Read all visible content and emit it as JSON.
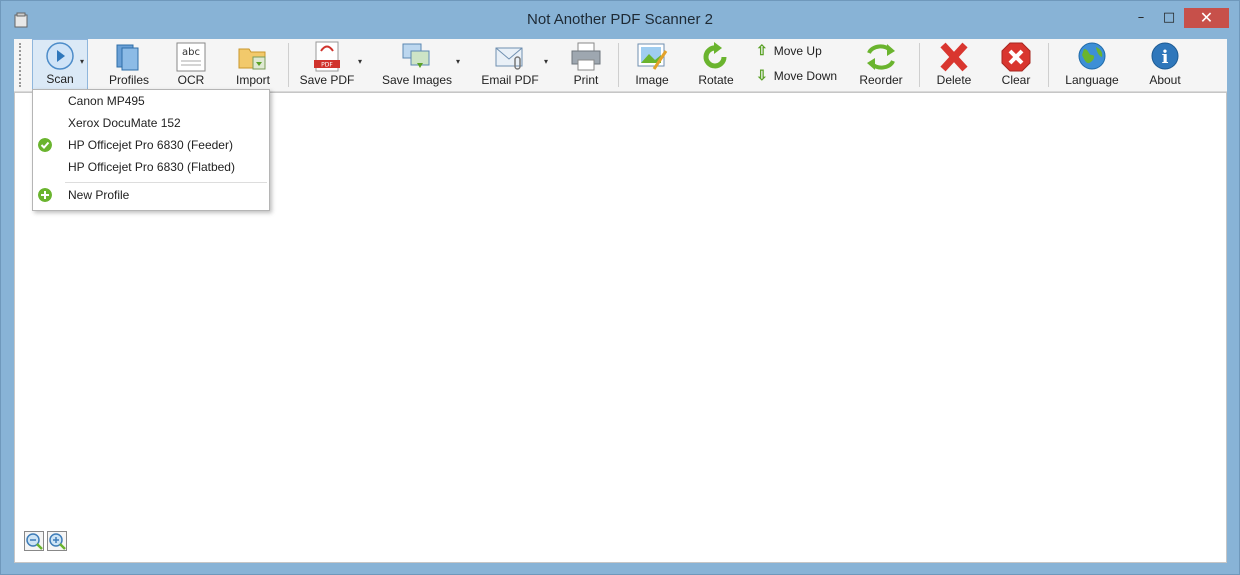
{
  "window": {
    "title": "Not Another PDF Scanner 2",
    "min_glyph": "–",
    "max_glyph": "□",
    "close_glyph": "✕"
  },
  "toolbar": {
    "scan": "Scan",
    "profiles": "Profiles",
    "ocr": "OCR",
    "ocr_icon_text": "abc",
    "import": "Import",
    "save_pdf": "Save PDF",
    "pdf_icon_text": "PDF",
    "save_images": "Save Images",
    "email_pdf": "Email PDF",
    "print": "Print",
    "image": "Image",
    "rotate": "Rotate",
    "move_up": "Move Up",
    "move_down": "Move Down",
    "reorder": "Reorder",
    "delete": "Delete",
    "clear": "Clear",
    "language": "Language",
    "about": "About",
    "about_icon_text": "i",
    "drop_glyph": "▾",
    "up_glyph": "⇧",
    "down_glyph": "⇩"
  },
  "scan_menu": {
    "items": [
      {
        "label": "Canon MP495",
        "checked": false
      },
      {
        "label": "Xerox DocuMate 152",
        "checked": false
      },
      {
        "label": "HP Officejet Pro 6830 (Feeder)",
        "checked": true
      },
      {
        "label": "HP Officejet Pro 6830 (Flatbed)",
        "checked": false
      }
    ],
    "new_profile": "New Profile"
  },
  "zoom": {
    "out_glyph": "−",
    "in_glyph": "+"
  },
  "colors": {
    "accent": "#88b3d6",
    "close_red": "#c7504a",
    "check_green": "#6ab42e"
  }
}
